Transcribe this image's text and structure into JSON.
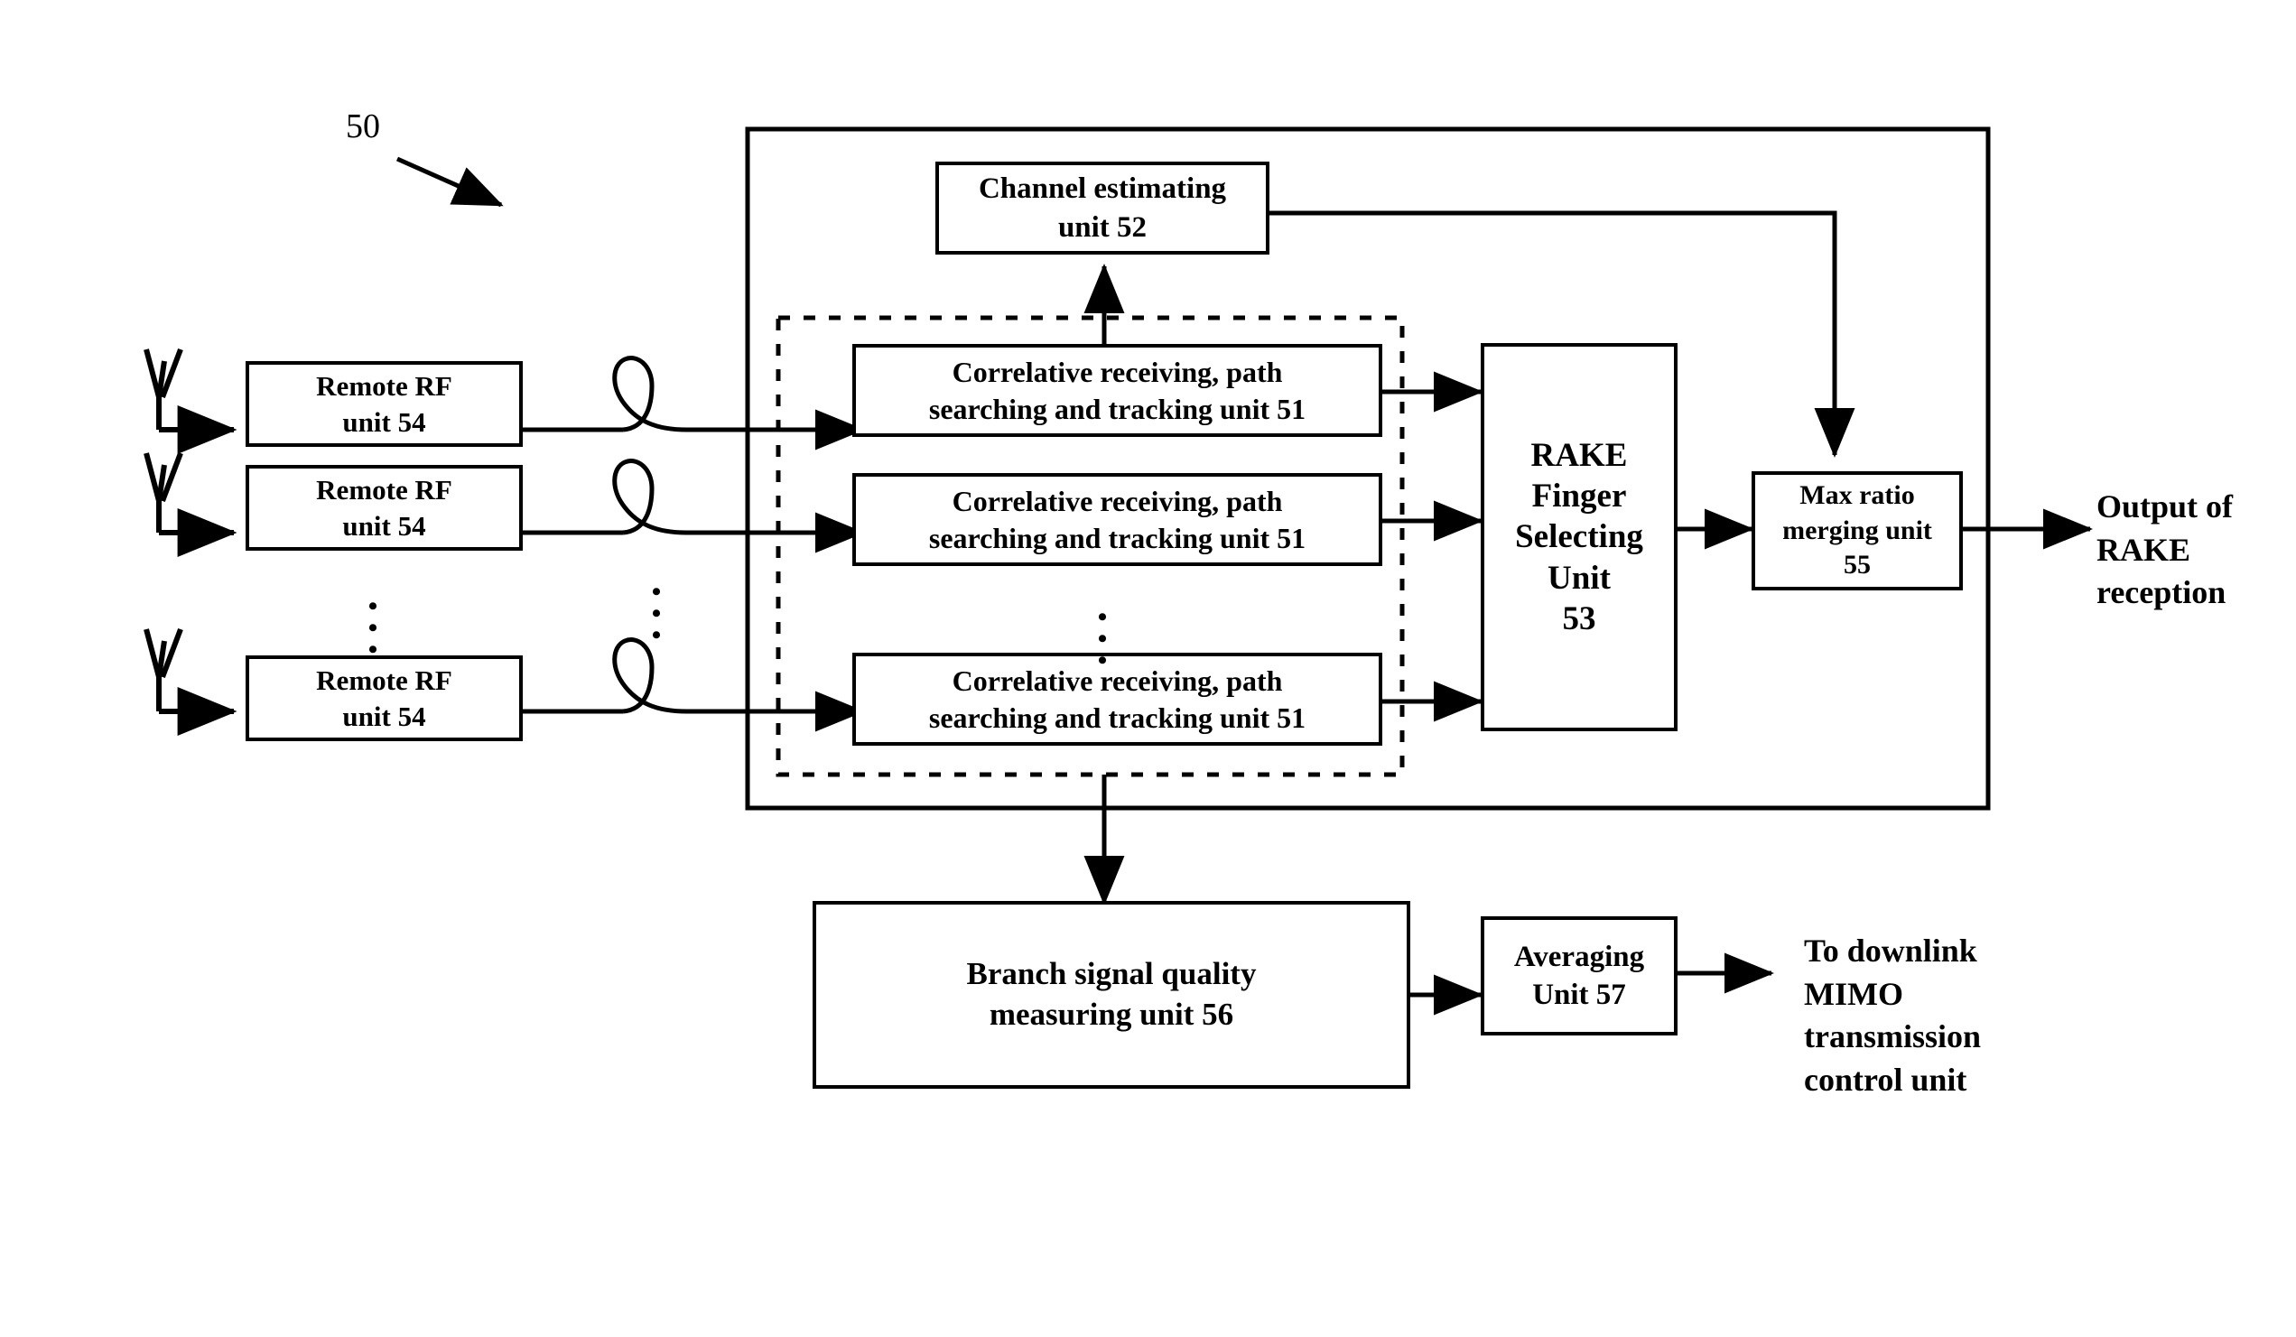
{
  "figure": {
    "reference_numeral": "50",
    "domain": "patent-block-diagram"
  },
  "antennas": [
    {
      "name": "antenna-1"
    },
    {
      "name": "antenna-2"
    },
    {
      "name": "antenna-n"
    }
  ],
  "remote_rf_units": [
    {
      "label": "Remote RF\nunit 54"
    },
    {
      "label": "Remote RF\nunit 54"
    },
    {
      "label": "Remote RF\nunit 54"
    }
  ],
  "correlative_units": [
    {
      "label": "Correlative receiving, path\nsearching and tracking unit 51"
    },
    {
      "label": "Correlative receiving, path\nsearching and tracking unit 51"
    },
    {
      "label": "Correlative receiving, path\nsearching and tracking unit 51"
    }
  ],
  "channel_estimating_unit": {
    "label": "Channel estimating\nunit 52"
  },
  "rake_finger_selecting_unit": {
    "label": "RAKE\nFinger\nSelecting\nUnit\n53"
  },
  "max_ratio_merging_unit": {
    "label": "Max ratio\nmerging unit\n55"
  },
  "branch_signal_quality_unit": {
    "label": "Branch signal quality\nmeasuring unit 56"
  },
  "averaging_unit": {
    "label": "Averaging\nUnit 57"
  },
  "outputs": {
    "rake_output": "Output of\nRAKE\nreception",
    "downlink": "To downlink\nMIMO\ntransmission\ncontrol unit"
  },
  "ellipses": {
    "rf_column": "•••",
    "fiber_column": "•••",
    "correlative_column": "•••"
  },
  "colors": {
    "ink": "#000000",
    "paper": "#ffffff"
  }
}
